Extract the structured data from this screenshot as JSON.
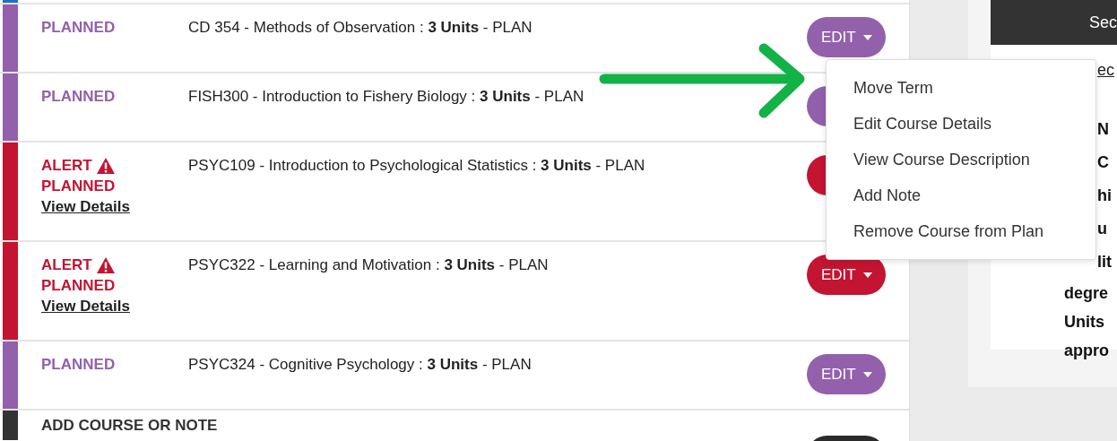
{
  "plan_rows": [
    {
      "kind": "partial",
      "color": "#1f6fc5"
    },
    {
      "kind": "planned",
      "color": "#9360ac",
      "status": "PLANNED",
      "course": "CD 354 - Methods of Observation : **3 Units** - PLAN",
      "button": {
        "label": "EDIT"
      }
    },
    {
      "kind": "planned",
      "color": "#9360ac",
      "status": "PLANNED",
      "course": "FISH300 - Introduction to Fishery Biology : **3 Units** - PLAN",
      "button": {}
    },
    {
      "kind": "alert",
      "color": "#c31432",
      "alert_label": "ALERT",
      "status": "PLANNED",
      "details_link": "View Details",
      "course": "PSYC109 - Introduction to Psychological Statistics : **3 Units** - PLAN",
      "button": {}
    },
    {
      "kind": "alert",
      "color": "#c31432",
      "alert_label": "ALERT",
      "status": "PLANNED",
      "details_link": "View Details",
      "course": "PSYC322 - Learning and Motivation : **3 Units** - PLAN",
      "button": {
        "label": "EDIT"
      }
    },
    {
      "kind": "planned",
      "color": "#9360ac",
      "status": "PLANNED",
      "course": "PSYC324 - Cognitive Psychology : **3 Units** - PLAN",
      "button": {
        "label": "EDIT"
      }
    },
    {
      "kind": "add",
      "color": "#333333",
      "status": "ADD COURSE OR NOTE"
    }
  ],
  "edit_menu": {
    "items": [
      "Move Term",
      "Edit Course Details",
      "View Course Description",
      "Add Note",
      "Remove Course from Plan"
    ]
  },
  "side_card": {
    "title": "Sec",
    "lines": [
      {
        "kind": "link",
        "text": "ec"
      },
      {
        "kind": "bold",
        "text": "N"
      },
      {
        "kind": "bold",
        "text": "C"
      },
      {
        "kind": "bold",
        "text": "hi"
      },
      {
        "kind": "bold",
        "text": "u"
      },
      {
        "kind": "bold",
        "text": "lit"
      },
      {
        "kind": "bold",
        "text": "degre"
      },
      {
        "kind": "bold",
        "text": "Units"
      },
      {
        "kind": "bold",
        "text": "appro"
      }
    ]
  }
}
